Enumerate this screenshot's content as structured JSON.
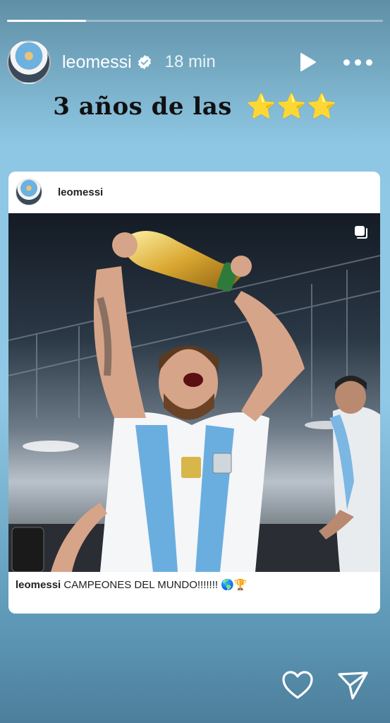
{
  "story": {
    "progress": 0.21,
    "username": "leomessi",
    "time": "18 min",
    "caption_text": "3 años de las",
    "caption_stars": "⭐⭐⭐"
  },
  "post": {
    "username": "leomessi",
    "caption_user": "leomessi",
    "caption_text": "CAMPEONES DEL MUNDO!!!!!!!",
    "caption_emoji": "🌎🏆"
  },
  "icons": {
    "verified": "verified-badge-icon",
    "play": "play-icon",
    "more": "more-dots-icon",
    "multi": "multi-photo-icon",
    "like": "heart-icon",
    "send": "send-icon"
  }
}
